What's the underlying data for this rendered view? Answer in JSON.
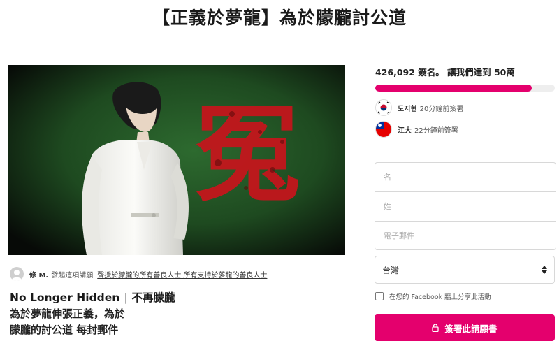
{
  "page": {
    "title": "【正義於夢龍】為於朦朧討公道"
  },
  "creator": {
    "name": "修 M.",
    "started_text": "發起這項請願",
    "recipient": "聲援於朦朧的所有善良人士 所有支持於夢龍的善良人士"
  },
  "petition": {
    "heading_en": "No Longer Hidden",
    "heading_zh": "不再朦朧",
    "body_line1": "為於夢龍伸張正義，為於",
    "body_line2": "朦朧的討公道 每封郵件"
  },
  "hero": {
    "calligraphy": "冤"
  },
  "stats": {
    "count_text": "426,092 簽名。 讓我們達到 50萬",
    "progress_fraction": 0.87
  },
  "signers": [
    {
      "name": "도지현",
      "time": "20分鐘前簽署",
      "flag": "korea-flag-icon"
    },
    {
      "name": "江大",
      "time": "22分鐘前簽署",
      "flag": "taiwan-flag-icon"
    }
  ],
  "form": {
    "name_placeholder": "名",
    "surname_placeholder": "姓",
    "email_placeholder": "電子郵件",
    "country_value": "台灣",
    "facebook_label": "在您的 Facebook 牆上分享此活動",
    "sign_label": "簽署此請願書"
  },
  "colors": {
    "accent": "#e4006d",
    "hero_bg": "#1f4a22",
    "calligraphy_red": "#c8141c"
  }
}
